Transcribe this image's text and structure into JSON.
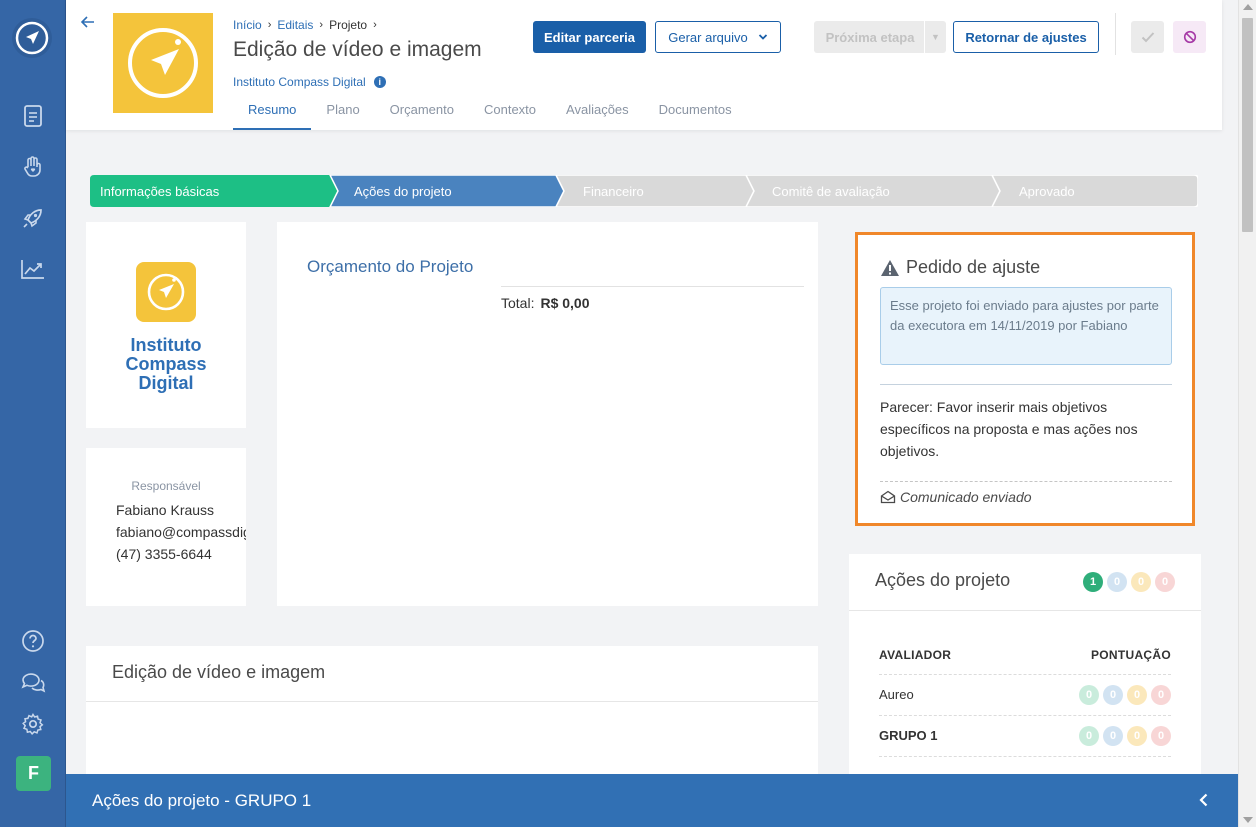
{
  "colors": {
    "sidebar": "#3566a6",
    "brand_yellow": "#f4c43b",
    "primary": "#1a5fa8",
    "step_done": "#1dbf85",
    "step_current": "#4a83bf",
    "step_pending": "#d9d9d9",
    "highlight_border": "#f0872a",
    "bottombar": "#3170b4"
  },
  "sidebar": {
    "logo_icon": "compass-logo-icon",
    "items": [
      {
        "icon": "document-icon"
      },
      {
        "icon": "hand-heart-icon"
      },
      {
        "icon": "rocket-icon"
      },
      {
        "icon": "chart-icon"
      }
    ],
    "bottom_items": [
      {
        "icon": "help-icon"
      },
      {
        "icon": "chat-icon"
      },
      {
        "icon": "gear-icon"
      }
    ],
    "avatar_letter": "F"
  },
  "header": {
    "breadcrumb": [
      "Início",
      "Editais",
      "Projeto"
    ],
    "title": "Edição de vídeo e imagem",
    "organization": "Instituto Compass Digital",
    "tabs": [
      "Resumo",
      "Plano",
      "Orçamento",
      "Contexto",
      "Avaliações",
      "Documentos"
    ],
    "active_tab": "Resumo",
    "buttons": {
      "edit": "Editar parceria",
      "generate": "Gerar arquivo",
      "next_step": "Próxima etapa",
      "return": "Retornar de ajustes"
    }
  },
  "stepper": {
    "steps": [
      {
        "label": "Informações básicas",
        "status": "done"
      },
      {
        "label": "Ações do projeto",
        "status": "current"
      },
      {
        "label": "Financeiro",
        "status": "pending"
      },
      {
        "label": "Comitê de avaliação",
        "status": "pending"
      },
      {
        "label": "Aprovado",
        "status": "pending"
      }
    ]
  },
  "org_card": {
    "name_lines": [
      "Instituto",
      "Compass",
      "Digital"
    ]
  },
  "responsible": {
    "label": "Responsável",
    "name": "Fabiano Krauss",
    "email": "fabiano@compassdigital.",
    "phone": "(47) 3355-6644"
  },
  "budget": {
    "title": "Orçamento do Projeto",
    "total_label": "Total:",
    "total_value": "R$ 0,00"
  },
  "description": {
    "title": "Edição de vídeo e imagem"
  },
  "adjustment": {
    "title": "Pedido de ajuste",
    "info": "Esse projeto foi enviado para ajustes por parte da executora em 14/11/2019 por Fabiano",
    "opinion": "Parecer: Favor inserir mais objetivos específicos na proposta e mas ações nos objetivos.",
    "sent": "Comunicado enviado"
  },
  "actions": {
    "title": "Ações do projeto",
    "summary_badges": [
      "1",
      "0",
      "0",
      "0"
    ],
    "col_evaluator": "AVALIADOR",
    "col_score": "PONTUAÇÃO",
    "rows": [
      {
        "name": "Aureo",
        "bold": false,
        "badges": [
          "0",
          "0",
          "0",
          "0"
        ]
      },
      {
        "name": "GRUPO 1",
        "bold": true,
        "badges": [
          "0",
          "0",
          "0",
          "0"
        ]
      }
    ]
  },
  "bottombar": {
    "title": "Ações do projeto - GRUPO 1"
  }
}
